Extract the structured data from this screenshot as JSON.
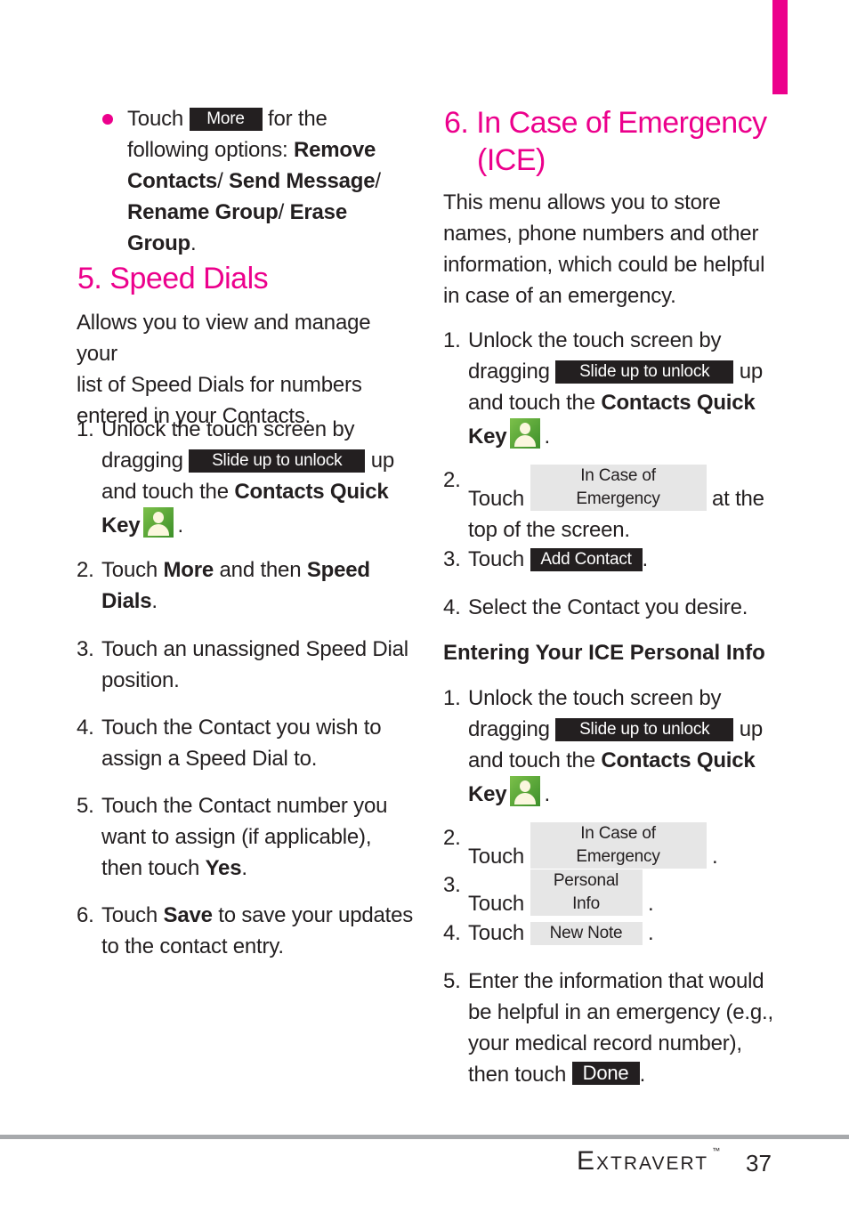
{
  "page": {
    "accent_color": "#ec008c",
    "footer": {
      "brand": "Extravert",
      "trademark": "™",
      "page_number": "37"
    }
  },
  "left": {
    "bullet": {
      "pre": "Touch",
      "button": "More",
      "post": "for the",
      "line2": "following options:",
      "options": [
        "Remove Contacts",
        "Send Message",
        "Rename Group",
        "Erase Group"
      ]
    },
    "section": {
      "title": "5. Speed Dials",
      "intro": [
        "Allows you to view and manage your",
        "list of Speed Dials for numbers",
        "entered in your Contacts."
      ],
      "steps": [
        {
          "num": "1.",
          "l1": "Unlock the touch screen by",
          "l2_pre": "dragging",
          "l2_button": "Slide up to unlock",
          "l2_post": "up",
          "l3_pre": "and touch the",
          "l3_bold": "Contacts Quick",
          "l4_bold": "Key",
          "l4_post": "."
        },
        {
          "num": "2.",
          "pre": "Touch",
          "b1": "More",
          "mid": "and then",
          "b2": "Speed",
          "b3": "Dials",
          "post": "."
        },
        {
          "num": "3.",
          "l1": "Touch an unassigned Speed Dial",
          "l2": "position."
        },
        {
          "num": "4.",
          "l1": "Touch the Contact you wish to",
          "l2": "assign a Speed Dial to."
        },
        {
          "num": "5.",
          "l1": "Touch the Contact number you",
          "l2": "want to assign (if applicable),",
          "l3_pre": "then touch",
          "l3_bold": "Yes",
          "l3_post": "."
        },
        {
          "num": "6.",
          "pre": "Touch",
          "bold": "Save",
          "post": "to save your updates",
          "l2": "to the contact entry."
        }
      ]
    }
  },
  "right": {
    "section": {
      "title_l1": "6. In Case of Emergency",
      "title_l2": "(ICE)",
      "intro": [
        "This menu allows you to store",
        "names, phone numbers and other",
        "information, which could be helpful",
        "in case of an emergency."
      ],
      "steps": [
        {
          "num": "1.",
          "l1": "Unlock the touch screen by",
          "l2_pre": "dragging",
          "l2_button": "Slide up to unlock",
          "l2_post": "up",
          "l3_pre": "and touch the",
          "l3_bold": "Contacts Quick",
          "l4_bold": "Key",
          "l4_post": "."
        },
        {
          "num": "2.",
          "pre": "Touch",
          "button": "In Case of Emergency",
          "post": "at the",
          "l2": "top of the screen."
        },
        {
          "num": "3.",
          "pre": "Touch",
          "button": "Add Contact",
          "post": "."
        },
        {
          "num": "4.",
          "l1": "Select the Contact you desire."
        }
      ]
    },
    "subsection": {
      "title": "Entering Your ICE Personal Info",
      "steps": [
        {
          "num": "1.",
          "l1": "Unlock the touch screen by",
          "l2_pre": "dragging",
          "l2_button": "Slide up to unlock",
          "l2_post": "up",
          "l3_pre": "and touch the",
          "l3_bold": "Contacts Quick",
          "l4_bold": "Key",
          "l4_post": "."
        },
        {
          "num": "2.",
          "pre": "Touch",
          "button": "In Case of Emergency",
          "post": "."
        },
        {
          "num": "3.",
          "pre": "Touch",
          "button": "Personal Info",
          "post": "."
        },
        {
          "num": "4.",
          "pre": "Touch",
          "button": "New Note",
          "post": "."
        },
        {
          "num": "5.",
          "l1": "Enter the information that would",
          "l2": "be helpful in an emergency (e.g.,",
          "l3": "your medical record number),",
          "l4_pre": "then touch",
          "l4_button": "Done",
          "l4_post": "."
        }
      ]
    }
  }
}
